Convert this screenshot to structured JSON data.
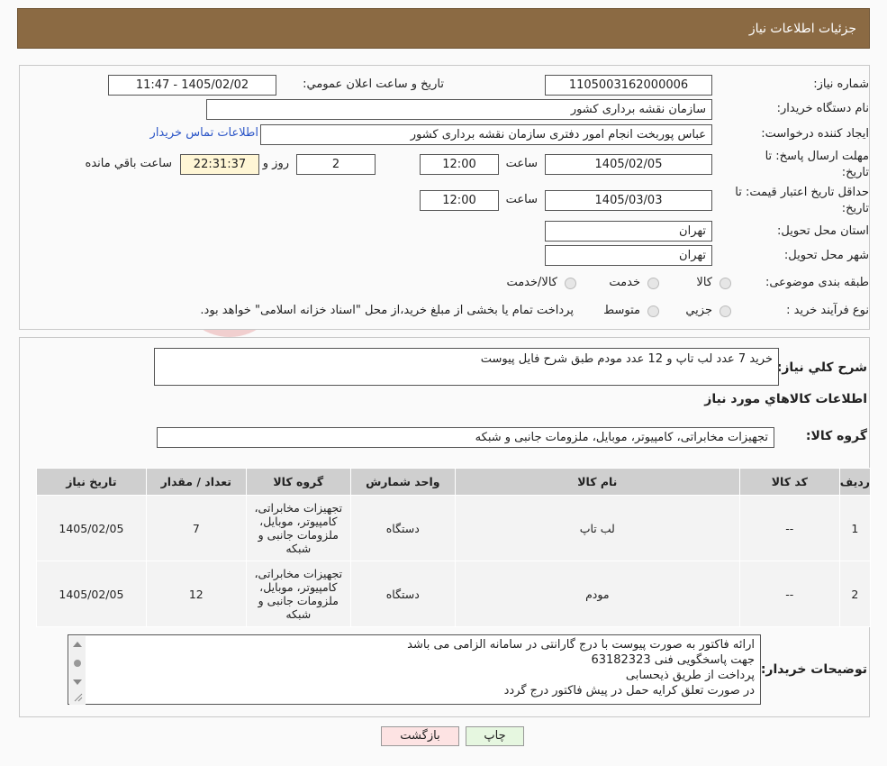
{
  "header": {
    "title": "جزئیات اطلاعات نیاز"
  },
  "form": {
    "need_number_label": "شماره نیاز:",
    "need_number": "1105003162000006",
    "announce_label": "تاریخ و ساعت اعلان عمومي:",
    "announce_value": "1405/02/02 - 11:47",
    "buyer_org_label": "نام دستگاه خریدار:",
    "buyer_org": "سازمان نقشه برداری کشور",
    "creator_label": "ایجاد کننده درخواست:",
    "creator": "عباس پوربخت انجام امور دفتری  سازمان نقشه برداری کشور",
    "contact_link": "اطلاعات تماس خریدار",
    "deadline_label_1": "مهلت ارسال پاسخ: تا",
    "deadline_label_2": "تاریخ:",
    "deadline_date": "1405/02/05",
    "time_label": "ساعت",
    "deadline_time": "12:00",
    "days_value": "2",
    "days_label": "روز و",
    "remaining_time": "22:31:37",
    "remaining_label": "ساعت باقي مانده",
    "validity_label_1": "حداقل تاریخ اعتبار قیمت: تا",
    "validity_label_2": "تاریخ:",
    "validity_date": "1405/03/03",
    "validity_time": "12:00",
    "province_label": "استان محل تحویل:",
    "province": "تهران",
    "city_label": "شهر محل تحویل:",
    "city": "تهران",
    "category_label": "طبقه بندی موضوعی:",
    "category_options": [
      "کالا",
      "خدمت",
      "کالا/خدمت"
    ],
    "process_label": "نوع فرآیند خرید :",
    "process_options": [
      "جزيي",
      "متوسط"
    ],
    "process_note": "پرداخت تمام یا بخشی از مبلغ خرید،از محل \"اسناد خزانه اسلامی\" خواهد بود."
  },
  "details": {
    "summary_label": "شرح کلي نیاز:",
    "summary": "خرید 7 عدد لب تاپ و 12 عدد مودم طبق شرح فایل پیوست",
    "items_title": "اطلاعات کالاهاي مورد نیاز",
    "group_label": "گروه کالا:",
    "group_value": "تجهیزات مخابراتی، کامپیوتر، موبایل، ملزومات جانبی و شبکه",
    "table": {
      "headers": [
        "ردیف",
        "کد کالا",
        "نام کالا",
        "واحد شمارش",
        "گروه کالا",
        "تعداد / مقدار",
        "تاریخ نیاز"
      ],
      "rows": [
        [
          "1",
          "--",
          "لب تاپ",
          "دستگاه",
          "تجهیزات مخابراتی، کامپیوتر، موبایل، ملزومات جانبی و شبکه",
          "7",
          "1405/02/05"
        ],
        [
          "2",
          "--",
          "مودم",
          "دستگاه",
          "تجهیزات مخابراتی، کامپیوتر، موبایل، ملزومات جانبی و شبکه",
          "12",
          "1405/02/05"
        ]
      ]
    },
    "buyer_notes_label": "توضیحات خریدار:",
    "buyer_notes": [
      "ارائه فاکتور به صورت پیوست  با درج گارانتی در سامانه الزامی می باشد",
      "جهت پاسخگویی فنی 63182323",
      "پرداخت از طریق ذیحسابی",
      "در صورت تعلق کرایه حمل در پیش فاکتور درج گردد"
    ]
  },
  "buttons": {
    "print": "چاپ",
    "back": "بازگشت"
  },
  "colors": {
    "header_bg": "#8b6a43",
    "link": "#2b55c7",
    "back_bg": "#fde3e3",
    "print_bg": "#e6f7e0"
  }
}
